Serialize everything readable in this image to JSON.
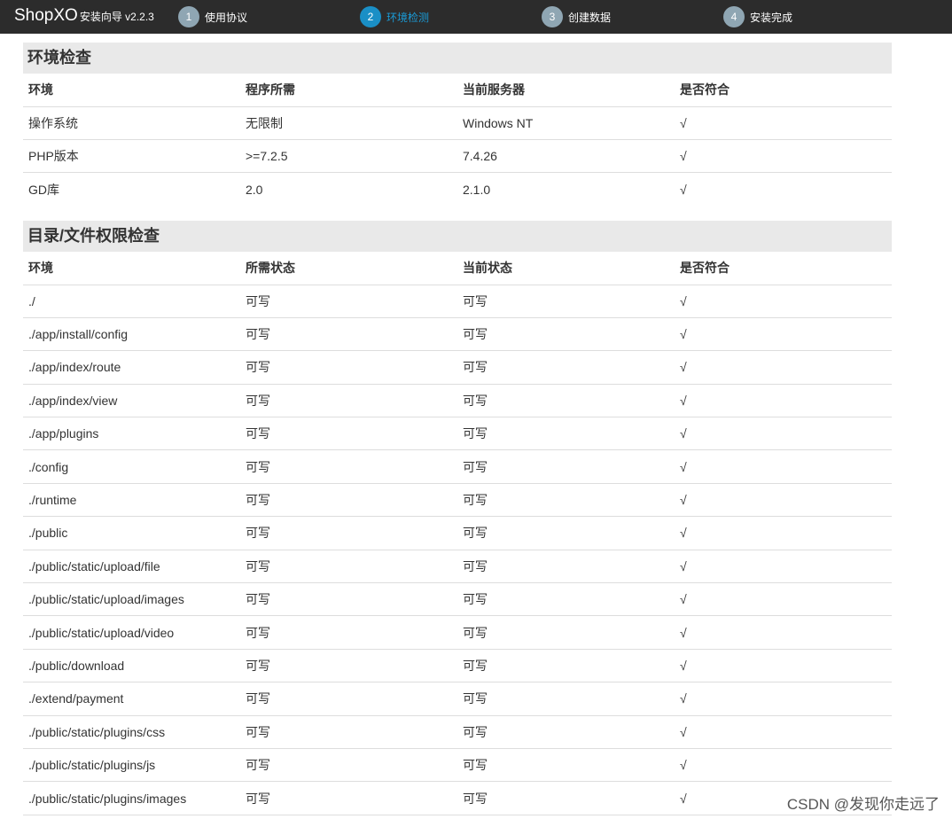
{
  "header": {
    "brand": "ShopXO",
    "subtitle": "安装向导 v2.2.3",
    "steps": [
      {
        "num": "1",
        "label": "使用协议"
      },
      {
        "num": "2",
        "label": "环境检测"
      },
      {
        "num": "3",
        "label": "创建数据"
      },
      {
        "num": "4",
        "label": "安装完成"
      }
    ],
    "active_step": 2
  },
  "env_check": {
    "title": "环境检查",
    "headers": [
      "环境",
      "程序所需",
      "当前服务器",
      "是否符合"
    ],
    "rows": [
      [
        "操作系统",
        "无限制",
        "Windows NT",
        "√"
      ],
      [
        "PHP版本",
        ">=7.2.5",
        "7.4.26",
        "√"
      ],
      [
        "GD库",
        "2.0",
        "2.1.0",
        "√"
      ]
    ]
  },
  "dir_check": {
    "title": "目录/文件权限检查",
    "headers": [
      "环境",
      "所需状态",
      "当前状态",
      "是否符合"
    ],
    "rows": [
      [
        "./",
        "可写",
        "可写",
        "√"
      ],
      [
        "./app/install/config",
        "可写",
        "可写",
        "√"
      ],
      [
        "./app/index/route",
        "可写",
        "可写",
        "√"
      ],
      [
        "./app/index/view",
        "可写",
        "可写",
        "√"
      ],
      [
        "./app/plugins",
        "可写",
        "可写",
        "√"
      ],
      [
        "./config",
        "可写",
        "可写",
        "√"
      ],
      [
        "./runtime",
        "可写",
        "可写",
        "√"
      ],
      [
        "./public",
        "可写",
        "可写",
        "√"
      ],
      [
        "./public/static/upload/file",
        "可写",
        "可写",
        "√"
      ],
      [
        "./public/static/upload/images",
        "可写",
        "可写",
        "√"
      ],
      [
        "./public/static/upload/video",
        "可写",
        "可写",
        "√"
      ],
      [
        "./public/download",
        "可写",
        "可写",
        "√"
      ],
      [
        "./extend/payment",
        "可写",
        "可写",
        "√"
      ],
      [
        "./public/static/plugins/css",
        "可写",
        "可写",
        "√"
      ],
      [
        "./public/static/plugins/js",
        "可写",
        "可写",
        "√"
      ],
      [
        "./public/static/plugins/images",
        "可写",
        "可写",
        "√"
      ]
    ]
  },
  "watermark": "CSDN @发现你走远了",
  "colors": {
    "topbar": "#2c2c2c",
    "step_inactive": "#8fa6b3",
    "step_active": "#1a8fc6",
    "section_header": "#e9e9e9"
  }
}
